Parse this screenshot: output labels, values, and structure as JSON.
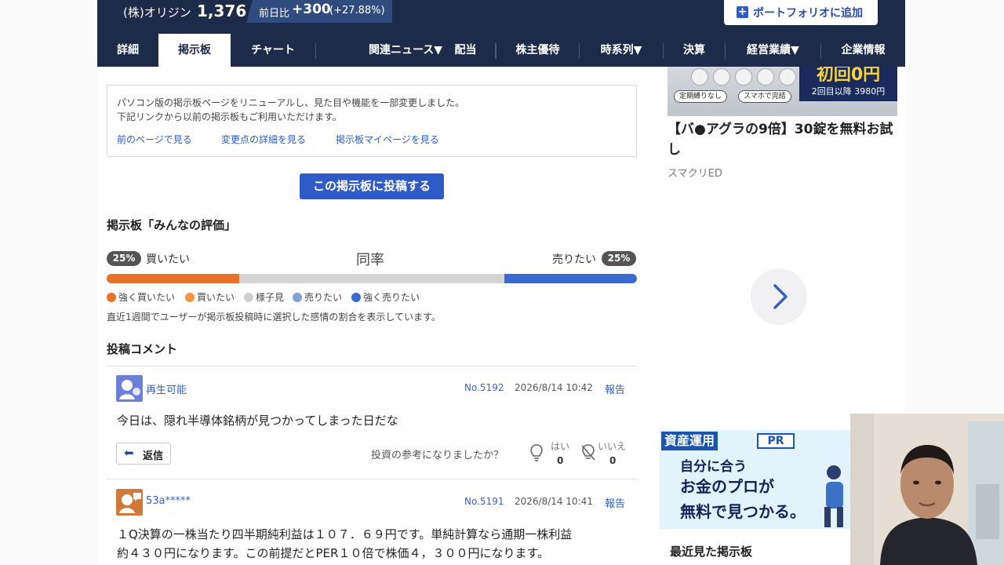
{
  "header": {
    "stock_name": "(株)オリジン",
    "price": "1,376",
    "change_label": "前日比",
    "change_value": "+300",
    "change_pct": "(+27.88%)",
    "portfolio_button": "ポートフォリオに追加"
  },
  "tabs": [
    {
      "label": "詳細"
    },
    {
      "label": "掲示板"
    },
    {
      "label": "チャート"
    },
    {
      "label": "関連ニュース▼"
    },
    {
      "label": "配当"
    },
    {
      "label": "株主優待"
    },
    {
      "label": "時系列▼"
    },
    {
      "label": "決算"
    },
    {
      "label": "経営業績▼"
    },
    {
      "label": "企業情報"
    }
  ],
  "notice": {
    "line1": "パソコン版の掲示板ページをリニューアルし、見た目や機能を一部変更しました。",
    "line2": "下記リンクから以前の掲示板もご利用いただけます。",
    "links": [
      "前のページで見る",
      "変更点の詳細を見る",
      "掲示板マイページを見る"
    ]
  },
  "post_button": "この掲示板に投稿する",
  "evaluation": {
    "title": "掲示板「みんなの評価」",
    "buy_pct": "25%",
    "buy_label": "買いたい",
    "center_label": "同率",
    "sell_label": "売りたい",
    "sell_pct": "25%",
    "bar_segments": [
      {
        "name": "強く買いたい",
        "fraction": 0.25,
        "color": "#e8702a"
      },
      {
        "name": "買いたい",
        "fraction": 0.0,
        "color": "#f0a060"
      },
      {
        "name": "様子見",
        "fraction": 0.5,
        "color": "#d5d5d5"
      },
      {
        "name": "売りたい",
        "fraction": 0.0,
        "color": "#7fa0dc"
      },
      {
        "name": "強く売りたい",
        "fraction": 0.25,
        "color": "#3a6ad0"
      }
    ],
    "legend": [
      {
        "label": "強く買いたい",
        "color": "#e8702a"
      },
      {
        "label": "買いたい",
        "color": "#f0954a"
      },
      {
        "label": "様子見",
        "color": "#cfcfcf"
      },
      {
        "label": "売りたい",
        "color": "#7fa0dc"
      },
      {
        "label": "強く売りたい",
        "color": "#3a6ad0"
      }
    ],
    "note": "直近1週間でユーザーが掲示板投稿時に選択した感情の割合を表示しています。"
  },
  "comments_title": "投稿コメント",
  "comments": [
    {
      "user": "再生可能",
      "no": "No.5192",
      "date": "2026/8/14 10:42",
      "report": "報告",
      "text": "今日は、隠れ半導体銘柄が見つかってしまった日だな",
      "reply": "返信",
      "helpful_question": "投資の参考になりましたか？",
      "yes_label": "はい",
      "yes_count": "0",
      "no_label": "いいえ",
      "no_count": "0"
    },
    {
      "user": "53a*****",
      "no": "No.5191",
      "date": "2026/8/14 10:41",
      "report": "報告",
      "text_line1": "１Q決算の一株当たり四半期純利益は１０７．６９円です。単純計算なら通期一株利益",
      "text_line2": "約４３０円になります。この前提だとPER１０倍で株価４，３００円になります。"
    }
  ],
  "sidebar": {
    "ad1_promo": "初回0円",
    "ad1_promo_sub": "2回目以降 3980円",
    "ad1_tags": [
      "定期縛りなし",
      "スマホで完結"
    ],
    "ad1_title": "【バ●アグラの9倍】30錠を無料お試し",
    "ad1_sponsor": "スマクリED",
    "next_icon": "chevron-right-icon",
    "ad2_head": "資産運用",
    "ad2_pr": "PR",
    "ad2_line1": "自分に合う",
    "ad2_line2": "お金のプロが",
    "ad2_line3": "無料で見つかる。",
    "recent_title": "最近見た掲示板"
  }
}
